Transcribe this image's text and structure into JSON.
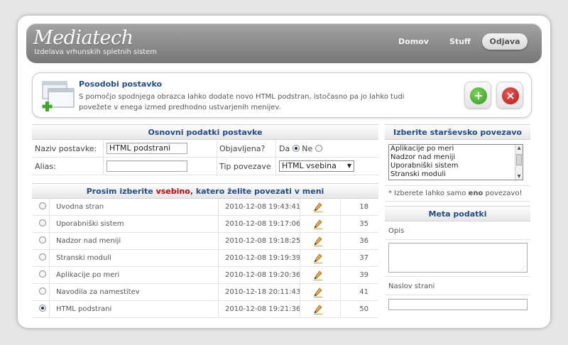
{
  "header": {
    "logo": "Mediatech",
    "tagline": "Izdelava vrhunskih spletnih sistem",
    "nav": [
      "Domov",
      "Stuff"
    ],
    "logout": "Odjava"
  },
  "info": {
    "title": "Posodobi postavko",
    "text": "S pomočjo spodnjega obrazca lahko dodate novo HTML podstran, istočasno pa jo lahko tudi povežete v enega izmed predhodno ustvarjenih menijev."
  },
  "basic": {
    "heading": "Osnovni podatki postavke",
    "name_label": "Naziv postavke:",
    "name_value": "HTML podstrani",
    "published_label": "Objavljena?",
    "yes_label": "Da",
    "no_label": "Ne",
    "alias_label": "Alias:",
    "alias_value": "",
    "link_type_label": "Tip povezave",
    "link_type_value": "HTML vsebina"
  },
  "content": {
    "heading_pre": "Prosim izberite ",
    "heading_em": "vsebino",
    "heading_post": ", katero želite povezati v meni",
    "rows": [
      {
        "title": "Uvodna stran",
        "date": "2010-12-08 19:43:41",
        "id": "18",
        "selected": false
      },
      {
        "title": "Uporabniški sistem",
        "date": "2010-12-08 19:17:06",
        "id": "35",
        "selected": false
      },
      {
        "title": "Nadzor nad meniji",
        "date": "2010-12-08 19:18:25",
        "id": "36",
        "selected": false
      },
      {
        "title": "Stranski moduli",
        "date": "2010-12-08 19:19:39",
        "id": "37",
        "selected": false
      },
      {
        "title": "Aplikacije po meri",
        "date": "2010-12-08 19:20:36",
        "id": "39",
        "selected": false
      },
      {
        "title": "Navodila za namestitev",
        "date": "2010-12-18 20:11:43",
        "id": "41",
        "selected": false
      },
      {
        "title": "HTML podstrani",
        "date": "2010-12-08 19:21:36",
        "id": "50",
        "selected": true
      }
    ]
  },
  "parent": {
    "heading": "Izberite starševsko povezavo",
    "options": [
      "Aplikacije po meri",
      "Nadzor nad meniji",
      "Uporabniški sistem",
      "Stranski moduli"
    ],
    "hint_pre": "* Izberete lahko samo ",
    "hint_em": "eno",
    "hint_post": " povezavo!"
  },
  "meta": {
    "heading": "Meta podatki",
    "desc_label": "Opis",
    "title_label": "Naslov strani"
  },
  "colors": {
    "accent": "#1f4c8e",
    "highlight": "#d40000",
    "add": "#2e9a1a",
    "delete": "#b81313"
  }
}
